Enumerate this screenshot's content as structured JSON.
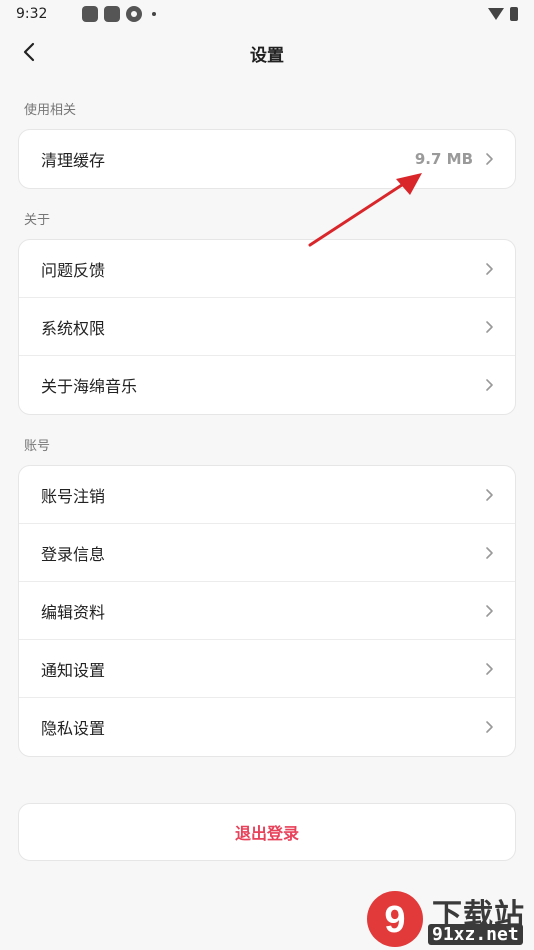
{
  "status_bar": {
    "time": "9:32"
  },
  "header": {
    "title": "设置"
  },
  "sections": [
    {
      "label": "使用相关",
      "items": [
        {
          "label": "清理缓存",
          "value": "9.7 MB"
        }
      ]
    },
    {
      "label": "关于",
      "items": [
        {
          "label": "问题反馈"
        },
        {
          "label": "系统权限"
        },
        {
          "label": "关于海绵音乐"
        }
      ]
    },
    {
      "label": "账号",
      "items": [
        {
          "label": "账号注销"
        },
        {
          "label": "登录信息"
        },
        {
          "label": "编辑资料"
        },
        {
          "label": "通知设置"
        },
        {
          "label": "隐私设置"
        }
      ]
    }
  ],
  "logout": {
    "label": "退出登录"
  },
  "colors": {
    "accent": "#e8415a",
    "annotation": "#d9262b"
  },
  "watermark": {
    "brand": "下载站",
    "url": "91xz.net",
    "mark": "9"
  }
}
